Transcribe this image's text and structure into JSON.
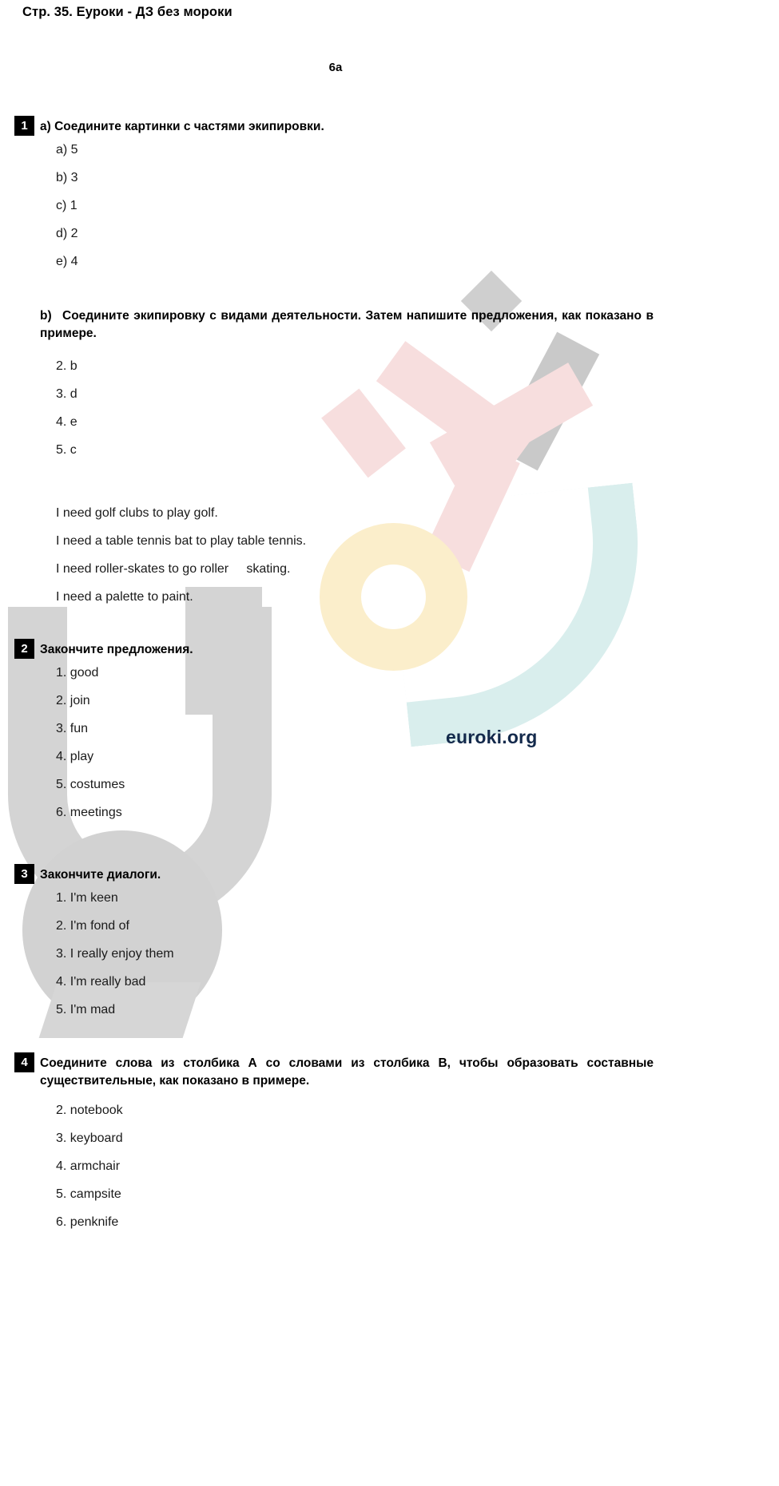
{
  "page": {
    "header": "Стр. 35. Еуроки - ДЗ без мороки",
    "unit_title": "6a",
    "brand": "euroki.org"
  },
  "tasks": [
    {
      "number": "1",
      "title": "a) Соедините картинки с частями экипировки.",
      "answers": [
        "a) 5",
        "b) 3",
        "c) 1",
        "d) 2",
        "e) 4"
      ],
      "sub": {
        "label": "b)",
        "title": "Соедините экипировку с видами деятельности. Затем напишите предложения, как показано в примере.",
        "answers": [
          "2. b",
          "3. d",
          "4. e",
          "5. c"
        ],
        "sentences": [
          "I need golf clubs to play golf.",
          "I need a table tennis bat to play table tennis.",
          "I need roller-skates to go roller     skating.",
          "I need a palette to paint."
        ]
      }
    },
    {
      "number": "2",
      "title": "Закончите предложения.",
      "answers": [
        "1. good",
        "2. join",
        "3. fun",
        "4. play",
        "5. costumes",
        "6. meetings"
      ]
    },
    {
      "number": "3",
      "title": "Закончите диалоги.",
      "answers": [
        "1. I'm keen",
        "2. I'm fond of",
        "3. I really enjoy them",
        "4. I'm really bad",
        "5. I'm mad"
      ]
    },
    {
      "number": "4",
      "title": "Соедините слова из столбика А со словами из столбика В, чтобы образовать составные существительные, как показано в примере.",
      "answers": [
        "2. notebook",
        "3. keyboard",
        "4. armchair",
        "5. campsite",
        "6. penknife"
      ]
    }
  ],
  "watermark": {
    "grey": "#d4d4d4",
    "pink": "#f7dede",
    "yellow": "#fbeecb",
    "teal": "#d9eeed"
  }
}
